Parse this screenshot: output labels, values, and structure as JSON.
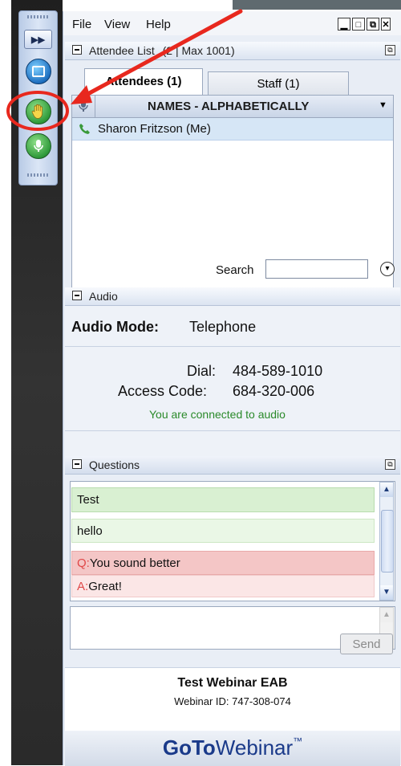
{
  "menu": {
    "file": "File",
    "view": "View",
    "help": "Help"
  },
  "attendee_list": {
    "title": "Attendee List",
    "count_text": "(2 | Max 1001)",
    "tabs": [
      {
        "label": "Attendees (1)"
      },
      {
        "label": "Staff (1)"
      }
    ],
    "column_header": "NAMES - ALPHABETICALLY",
    "rows": [
      {
        "name": "Sharon Fritzson (Me)"
      }
    ],
    "search_label": "Search",
    "search_value": ""
  },
  "audio": {
    "title": "Audio",
    "mode_label": "Audio Mode:",
    "mode_value": "Telephone",
    "dial_label": "Dial:",
    "dial_value": "484-589-1010",
    "access_label": "Access Code:",
    "access_value": "684-320-006",
    "status": "You are connected to audio"
  },
  "questions": {
    "title": "Questions",
    "items": [
      {
        "prefix": "",
        "text": "Test"
      },
      {
        "prefix": "",
        "text": "hello"
      },
      {
        "prefix": "Q:",
        "text": "You sound better"
      },
      {
        "prefix": "A:",
        "text": "Great!"
      }
    ],
    "input_value": "",
    "send_label": "Send"
  },
  "footer": {
    "webinar_title": "Test Webinar EAB",
    "webinar_id": "Webinar ID: 747-308-074",
    "brand_goto": "GoTo",
    "brand_webinar": "Webinar",
    "brand_tm": "™"
  },
  "icons": {
    "raise_hand": "raise-hand-icon",
    "phone": "phone-icon",
    "mic": "microphone-icon"
  },
  "colors": {
    "accent_blue": "#1e6fc0",
    "connected_green": "#2a8a2a",
    "question_red": "#e04848",
    "annotation_red": "#e8281e"
  }
}
